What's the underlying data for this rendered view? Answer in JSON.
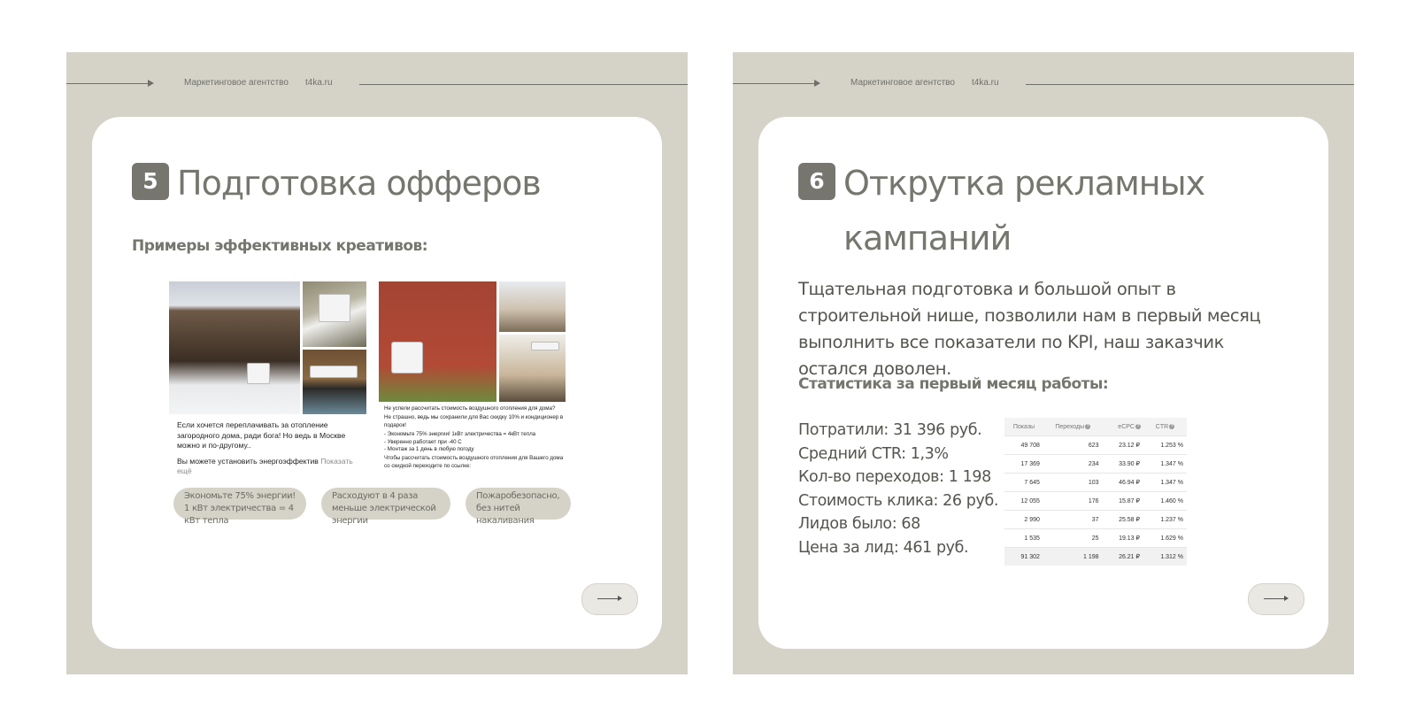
{
  "header": {
    "agency": "Маркетинговое агентство",
    "site": "t4ka.ru"
  },
  "slide_left": {
    "number": "5",
    "title": "Подготовка офферов",
    "subhead": "Примеры эффективных креативов:",
    "creative1": {
      "text_line1": "Если хочется переплачивать за отопление загородного дома, ради бога! Но ведь в Москве можно и по-другому..",
      "text_line2": "Вы можете установить энергоэффектив",
      "more": "Показать ещё"
    },
    "creative2": {
      "line1": "Не успели рассчитать стоимость воздушного отопления для дома?",
      "line2": "Не страшно, ведь мы сохранили для Вас скидку 10% и кондиционер в подарок!",
      "line3": "- Экономьте 75% энергии! 1кВт электричества = 4кВт тепла",
      "line4": "- Уверенно работает при -40 С",
      "line5": "- Монтаж за 1 день в любую погоду",
      "line6": "Чтобы рассчитать стоимость воздушного отопления для Вашего дома со скидкой переходите по ссылке:"
    },
    "pills": [
      "Экономьте 75% энергии! 1 кВт электричества = 4 кВт тепла",
      "Расходуют в 4 раза меньше электрической энергии",
      "Пожаробезопасно, без нитей накаливания"
    ]
  },
  "slide_right": {
    "number": "6",
    "title": "Открутка рекламных кампаний",
    "lead": "Тщательная подготовка и большой опыт в строительной нише, позволили нам в первый месяц выполнить все показатели по KPI, наш заказчик остался доволен.",
    "subhead": "Статистика за первый месяц работы:",
    "stats": [
      "Потратили: 31 396 руб.",
      "Средний CTR: 1,3%",
      "Кол-во переходов: 1 198",
      "Стоимость клика: 26 руб.",
      "Лидов было: 68",
      "Цена за лид: 461 руб."
    ],
    "table": {
      "headers": [
        "Показы",
        "Переходы",
        "eCPC",
        "CTR"
      ],
      "rows": [
        [
          "49 708",
          "623",
          "23.12 ₽",
          "1.253 %"
        ],
        [
          "17 369",
          "234",
          "33.90 ₽",
          "1.347 %"
        ],
        [
          "7 645",
          "103",
          "46.94 ₽",
          "1.347 %"
        ],
        [
          "12 055",
          "176",
          "15.87 ₽",
          "1.460 %"
        ],
        [
          "2 990",
          "37",
          "25.58 ₽",
          "1.237 %"
        ],
        [
          "1 535",
          "25",
          "19.13 ₽",
          "1.629 %"
        ],
        [
          "91 302",
          "1 198",
          "26.21 ₽",
          "1.312 %"
        ]
      ]
    }
  },
  "icons": {
    "question": "?"
  }
}
